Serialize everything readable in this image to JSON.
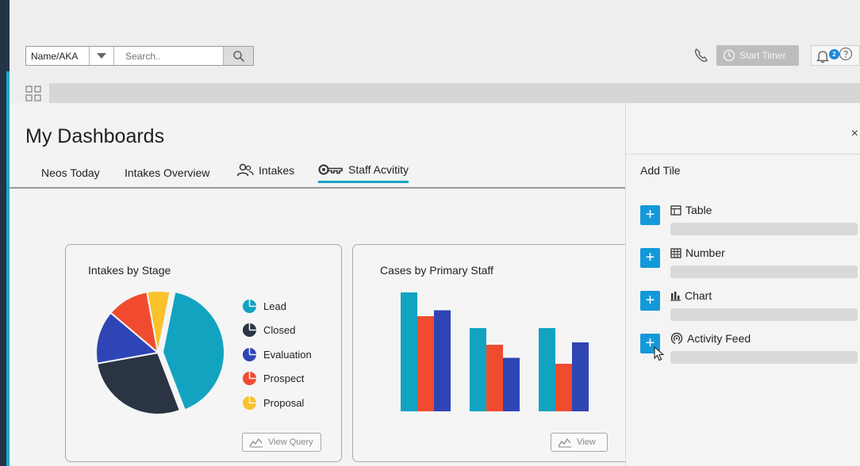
{
  "search": {
    "type_label": "Name/AKA",
    "placeholder": "Search.."
  },
  "header": {
    "timer_label": "Start Timer",
    "notification_count": "2"
  },
  "page": {
    "title": "My Dashboards"
  },
  "tabs": [
    {
      "label": "Neos Today",
      "icon": "",
      "active": false
    },
    {
      "label": "Intakes Overview",
      "icon": "",
      "active": false
    },
    {
      "label": "Intakes",
      "icon": "people-icon",
      "active": false
    },
    {
      "label": "Staff Acvitity",
      "icon": "key-icon",
      "active": true
    }
  ],
  "cards": {
    "pie": {
      "title": "Intakes by Stage",
      "link_label": "View Query"
    },
    "bar": {
      "title": "Cases by Primary Staff",
      "link_label": "View"
    }
  },
  "colors": {
    "accent": "#1aa3c3",
    "teal": "#12a3c1",
    "navy": "#2a3442",
    "blue": "#2f45b5",
    "red": "#f04b2f",
    "yellow": "#fbc12c",
    "add_button": "#1399d9"
  },
  "chart_data": [
    {
      "type": "pie",
      "title": "Intakes by Stage",
      "categories": [
        "Lead",
        "Closed",
        "Evaluation",
        "Prospect",
        "Proposal"
      ],
      "values": [
        41,
        28,
        14,
        11,
        6
      ],
      "colors": [
        "#12a3c1",
        "#2a3442",
        "#2f45b5",
        "#f04b2f",
        "#fbc12c"
      ],
      "legend": "right"
    },
    {
      "type": "bar",
      "title": "Cases by Primary Staff",
      "categories": [
        "",
        "",
        ""
      ],
      "series": [
        {
          "values": [
            10,
            7,
            7
          ],
          "color": "#12a3c1"
        },
        {
          "values": [
            8,
            5.6,
            4
          ],
          "color": "#f04b2f"
        },
        {
          "values": [
            8.5,
            4.5,
            5.8
          ],
          "color": "#2f45b5"
        }
      ],
      "ylim": [
        0,
        10
      ],
      "grid": false,
      "legend": "none"
    }
  ],
  "panel": {
    "title": "Add Tile",
    "close_label": "×",
    "tiles": [
      {
        "label": "Table",
        "icon": "table-icon"
      },
      {
        "label": "Number",
        "icon": "number-grid-icon"
      },
      {
        "label": "Chart",
        "icon": "bar-chart-icon"
      },
      {
        "label": "Activity Feed",
        "icon": "activity-feed-icon"
      }
    ]
  }
}
